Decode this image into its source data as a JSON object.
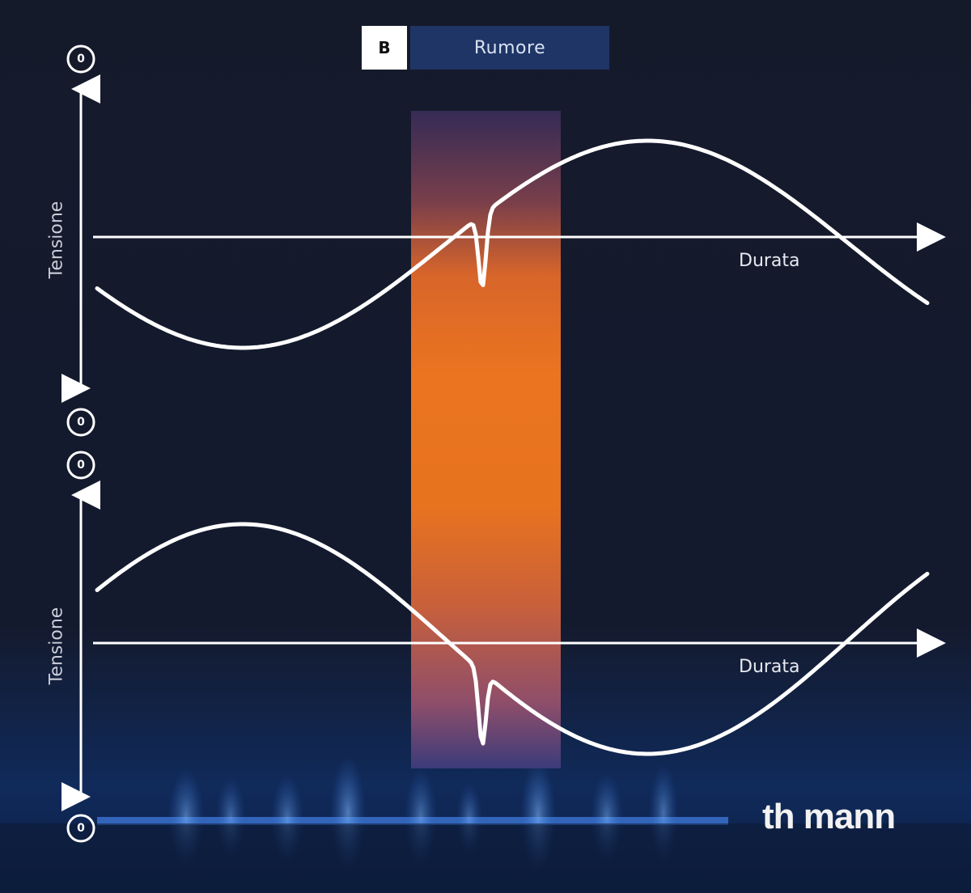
{
  "legend": {
    "swatch_text": "B",
    "label": "Rumore"
  },
  "panels": [
    {
      "axis_title": "Tensione",
      "time_label": "Durata"
    },
    {
      "axis_title": "Tensione",
      "time_label": "Durata"
    }
  ],
  "markers": [
    "0",
    "0",
    "0",
    "0"
  ],
  "brand": "th mann",
  "colors": {
    "background": "#15192b",
    "noise_band": "#e8731f",
    "wave": "#ffffff",
    "glow": "#3d8dff"
  }
}
